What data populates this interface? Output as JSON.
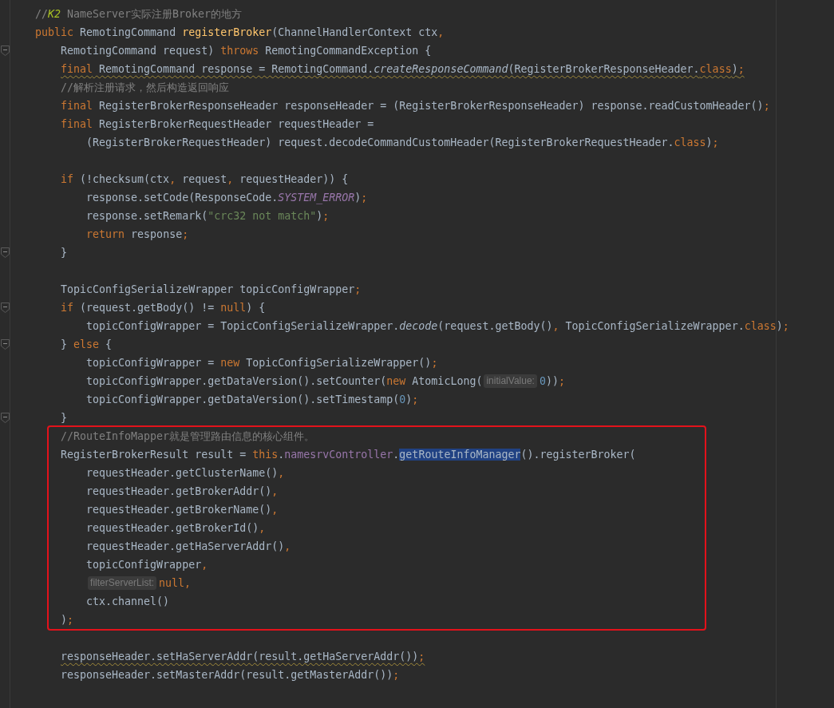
{
  "blocks": [
    {
      "kind": "code",
      "lines": [
        {
          "kind": "code",
          "tokens": [
            {
              "kind": "comment",
              "text": "//"
            },
            {
              "kind": "todo",
              "text": "K2"
            },
            {
              "kind": "comment",
              "text": " NameServer实际注册Broker的地方"
            }
          ]
        },
        {
          "kind": "code",
          "tokens": [
            {
              "kind": "keyword",
              "text": "public"
            },
            {
              "kind": "plain",
              "text": " RemotingCommand "
            },
            {
              "kind": "declaration",
              "text": "registerBroker"
            },
            {
              "kind": "plain",
              "text": "(ChannelHandlerContext ctx"
            },
            {
              "kind": "keyword",
              "text": ","
            }
          ]
        },
        {
          "kind": "code",
          "fold_marker": true,
          "tokens": [
            {
              "kind": "plain",
              "text": "    RemotingCommand request) "
            },
            {
              "kind": "keyword",
              "text": "throws"
            },
            {
              "kind": "plain",
              "text": " RemotingCommandException {"
            }
          ]
        },
        {
          "kind": "code",
          "warning": true,
          "tokens": [
            {
              "kind": "keyword",
              "text": "    final"
            },
            {
              "kind": "plain",
              "text": " RemotingCommand response = RemotingCommand."
            },
            {
              "kind": "static",
              "text": "createResponseCommand"
            },
            {
              "kind": "plain",
              "text": "(RegisterBrokerResponseHeader."
            },
            {
              "kind": "keyword",
              "text": "class"
            },
            {
              "kind": "plain",
              "text": ")"
            },
            {
              "kind": "keyword",
              "text": ";"
            }
          ]
        },
        {
          "kind": "code",
          "tokens": [
            {
              "kind": "comment",
              "text": "    //解析注册请求，然后构造返回响应"
            }
          ]
        },
        {
          "kind": "code",
          "tokens": [
            {
              "kind": "keyword",
              "text": "    final"
            },
            {
              "kind": "plain",
              "text": " RegisterBrokerResponseHeader responseHeader = (RegisterBrokerResponseHeader) response.readCustomHeader()"
            },
            {
              "kind": "keyword",
              "text": ";"
            }
          ]
        },
        {
          "kind": "code",
          "tokens": [
            {
              "kind": "keyword",
              "text": "    final"
            },
            {
              "kind": "plain",
              "text": " RegisterBrokerRequestHeader requestHeader ="
            }
          ]
        },
        {
          "kind": "code",
          "tokens": [
            {
              "kind": "plain",
              "text": "        (RegisterBrokerRequestHeader) request.decodeCommandCustomHeader(RegisterBrokerRequestHeader."
            },
            {
              "kind": "keyword",
              "text": "class"
            },
            {
              "kind": "plain",
              "text": ")"
            },
            {
              "kind": "keyword",
              "text": ";"
            }
          ]
        },
        {
          "kind": "blank"
        },
        {
          "kind": "code",
          "tokens": [
            {
              "kind": "keyword",
              "text": "    if"
            },
            {
              "kind": "plain",
              "text": " (!checksum(ctx"
            },
            {
              "kind": "keyword",
              "text": ","
            },
            {
              "kind": "plain",
              "text": " request"
            },
            {
              "kind": "keyword",
              "text": ","
            },
            {
              "kind": "plain",
              "text": " requestHeader)) {"
            }
          ]
        },
        {
          "kind": "code",
          "tokens": [
            {
              "kind": "plain",
              "text": "        response.setCode(ResponseCode."
            },
            {
              "kind": "constant",
              "text": "SYSTEM_ERROR"
            },
            {
              "kind": "plain",
              "text": ")"
            },
            {
              "kind": "keyword",
              "text": ";"
            }
          ]
        },
        {
          "kind": "code",
          "tokens": [
            {
              "kind": "plain",
              "text": "        response.setRemark("
            },
            {
              "kind": "string",
              "text": "\"crc32 not match\""
            },
            {
              "kind": "plain",
              "text": ")"
            },
            {
              "kind": "keyword",
              "text": ";"
            }
          ]
        },
        {
          "kind": "code",
          "tokens": [
            {
              "kind": "keyword",
              "text": "        return"
            },
            {
              "kind": "plain",
              "text": " response"
            },
            {
              "kind": "keyword",
              "text": ";"
            }
          ]
        },
        {
          "kind": "code",
          "fold_marker": true,
          "tokens": [
            {
              "kind": "plain",
              "text": "    }"
            }
          ]
        },
        {
          "kind": "blank"
        },
        {
          "kind": "code",
          "tokens": [
            {
              "kind": "plain",
              "text": "    TopicConfigSerializeWrapper topicConfigWrapper"
            },
            {
              "kind": "keyword",
              "text": ";"
            }
          ]
        },
        {
          "kind": "code",
          "fold_marker": true,
          "tokens": [
            {
              "kind": "keyword",
              "text": "    if"
            },
            {
              "kind": "plain",
              "text": " (request.getBody() != "
            },
            {
              "kind": "keyword",
              "text": "null"
            },
            {
              "kind": "plain",
              "text": ") {"
            }
          ]
        },
        {
          "kind": "code",
          "tokens": [
            {
              "kind": "plain",
              "text": "        topicConfigWrapper = TopicConfigSerializeWrapper."
            },
            {
              "kind": "static",
              "text": "decode"
            },
            {
              "kind": "plain",
              "text": "(request.getBody()"
            },
            {
              "kind": "keyword",
              "text": ","
            },
            {
              "kind": "plain",
              "text": " TopicConfigSerializeWrapper."
            },
            {
              "kind": "keyword",
              "text": "class"
            },
            {
              "kind": "plain",
              "text": ")"
            },
            {
              "kind": "keyword",
              "text": ";"
            }
          ]
        },
        {
          "kind": "code",
          "fold_marker": true,
          "tokens": [
            {
              "kind": "plain",
              "text": "    } "
            },
            {
              "kind": "keyword",
              "text": "else"
            },
            {
              "kind": "plain",
              "text": " {"
            }
          ]
        },
        {
          "kind": "code",
          "tokens": [
            {
              "kind": "plain",
              "text": "        topicConfigWrapper = "
            },
            {
              "kind": "keyword",
              "text": "new"
            },
            {
              "kind": "plain",
              "text": " TopicConfigSerializeWrapper()"
            },
            {
              "kind": "keyword",
              "text": ";"
            }
          ]
        },
        {
          "kind": "code",
          "tokens": [
            {
              "kind": "plain",
              "text": "        topicConfigWrapper.getDataVersion().setCounter("
            },
            {
              "kind": "keyword",
              "text": "new"
            },
            {
              "kind": "plain",
              "text": " AtomicLong("
            },
            {
              "kind": "hint",
              "text": "initialValue:"
            },
            {
              "kind": "number",
              "text": "0"
            },
            {
              "kind": "plain",
              "text": "))"
            },
            {
              "kind": "keyword",
              "text": ";"
            }
          ]
        },
        {
          "kind": "code",
          "tokens": [
            {
              "kind": "plain",
              "text": "        topicConfigWrapper.getDataVersion().setTimestamp("
            },
            {
              "kind": "number",
              "text": "0"
            },
            {
              "kind": "plain",
              "text": ")"
            },
            {
              "kind": "keyword",
              "text": ";"
            }
          ]
        },
        {
          "kind": "code",
          "fold_marker": true,
          "tokens": [
            {
              "kind": "plain",
              "text": "    }"
            }
          ]
        }
      ]
    },
    {
      "kind": "marked",
      "lines": [
        {
          "kind": "code",
          "tokens": [
            {
              "kind": "comment",
              "text": "    //RouteInfoMapper就是管理路由信息的核心组件。"
            }
          ]
        },
        {
          "kind": "code",
          "tokens": [
            {
              "kind": "plain",
              "text": "    RegisterBrokerResult result = "
            },
            {
              "kind": "keyword",
              "text": "this"
            },
            {
              "kind": "plain",
              "text": "."
            },
            {
              "kind": "field",
              "text": "namesrvController"
            },
            {
              "kind": "plain",
              "text": "."
            },
            {
              "kind": "selected",
              "text": "getRouteInfoManager"
            },
            {
              "kind": "plain",
              "text": "().registerBroker("
            }
          ]
        },
        {
          "kind": "code",
          "tokens": [
            {
              "kind": "plain",
              "text": "        requestHeader.getClusterName()"
            },
            {
              "kind": "keyword",
              "text": ","
            }
          ]
        },
        {
          "kind": "code",
          "tokens": [
            {
              "kind": "plain",
              "text": "        requestHeader.getBrokerAddr()"
            },
            {
              "kind": "keyword",
              "text": ","
            }
          ]
        },
        {
          "kind": "code",
          "tokens": [
            {
              "kind": "plain",
              "text": "        requestHeader.getBrokerName()"
            },
            {
              "kind": "keyword",
              "text": ","
            }
          ]
        },
        {
          "kind": "code",
          "tokens": [
            {
              "kind": "plain",
              "text": "        requestHeader.getBrokerId()"
            },
            {
              "kind": "keyword",
              "text": ","
            }
          ]
        },
        {
          "kind": "code",
          "tokens": [
            {
              "kind": "plain",
              "text": "        requestHeader.getHaServerAddr()"
            },
            {
              "kind": "keyword",
              "text": ","
            }
          ]
        },
        {
          "kind": "code",
          "tokens": [
            {
              "kind": "plain",
              "text": "        topicConfigWrapper"
            },
            {
              "kind": "keyword",
              "text": ","
            }
          ]
        },
        {
          "kind": "code",
          "tokens": [
            {
              "kind": "hint",
              "text": "        filterServerList:"
            },
            {
              "kind": "keyword",
              "text": "null,"
            }
          ]
        },
        {
          "kind": "code",
          "tokens": [
            {
              "kind": "plain",
              "text": "        ctx.channel()"
            }
          ]
        },
        {
          "kind": "code",
          "tokens": [
            {
              "kind": "plain",
              "text": "    )"
            },
            {
              "kind": "keyword",
              "text": ";"
            }
          ]
        }
      ]
    },
    {
      "kind": "code",
      "lines": [
        {
          "kind": "blank"
        },
        {
          "kind": "code",
          "warning": true,
          "tokens": [
            {
              "kind": "plain",
              "text": "    responseHeader.setHaServerAddr(result.getHaServerAddr())"
            },
            {
              "kind": "keyword",
              "text": ";"
            }
          ]
        },
        {
          "kind": "code",
          "tokens": [
            {
              "kind": "plain",
              "text": "    responseHeader.setMasterAddr(result.getMasterAddr())"
            },
            {
              "kind": "keyword",
              "text": ";"
            }
          ]
        }
      ]
    }
  ]
}
